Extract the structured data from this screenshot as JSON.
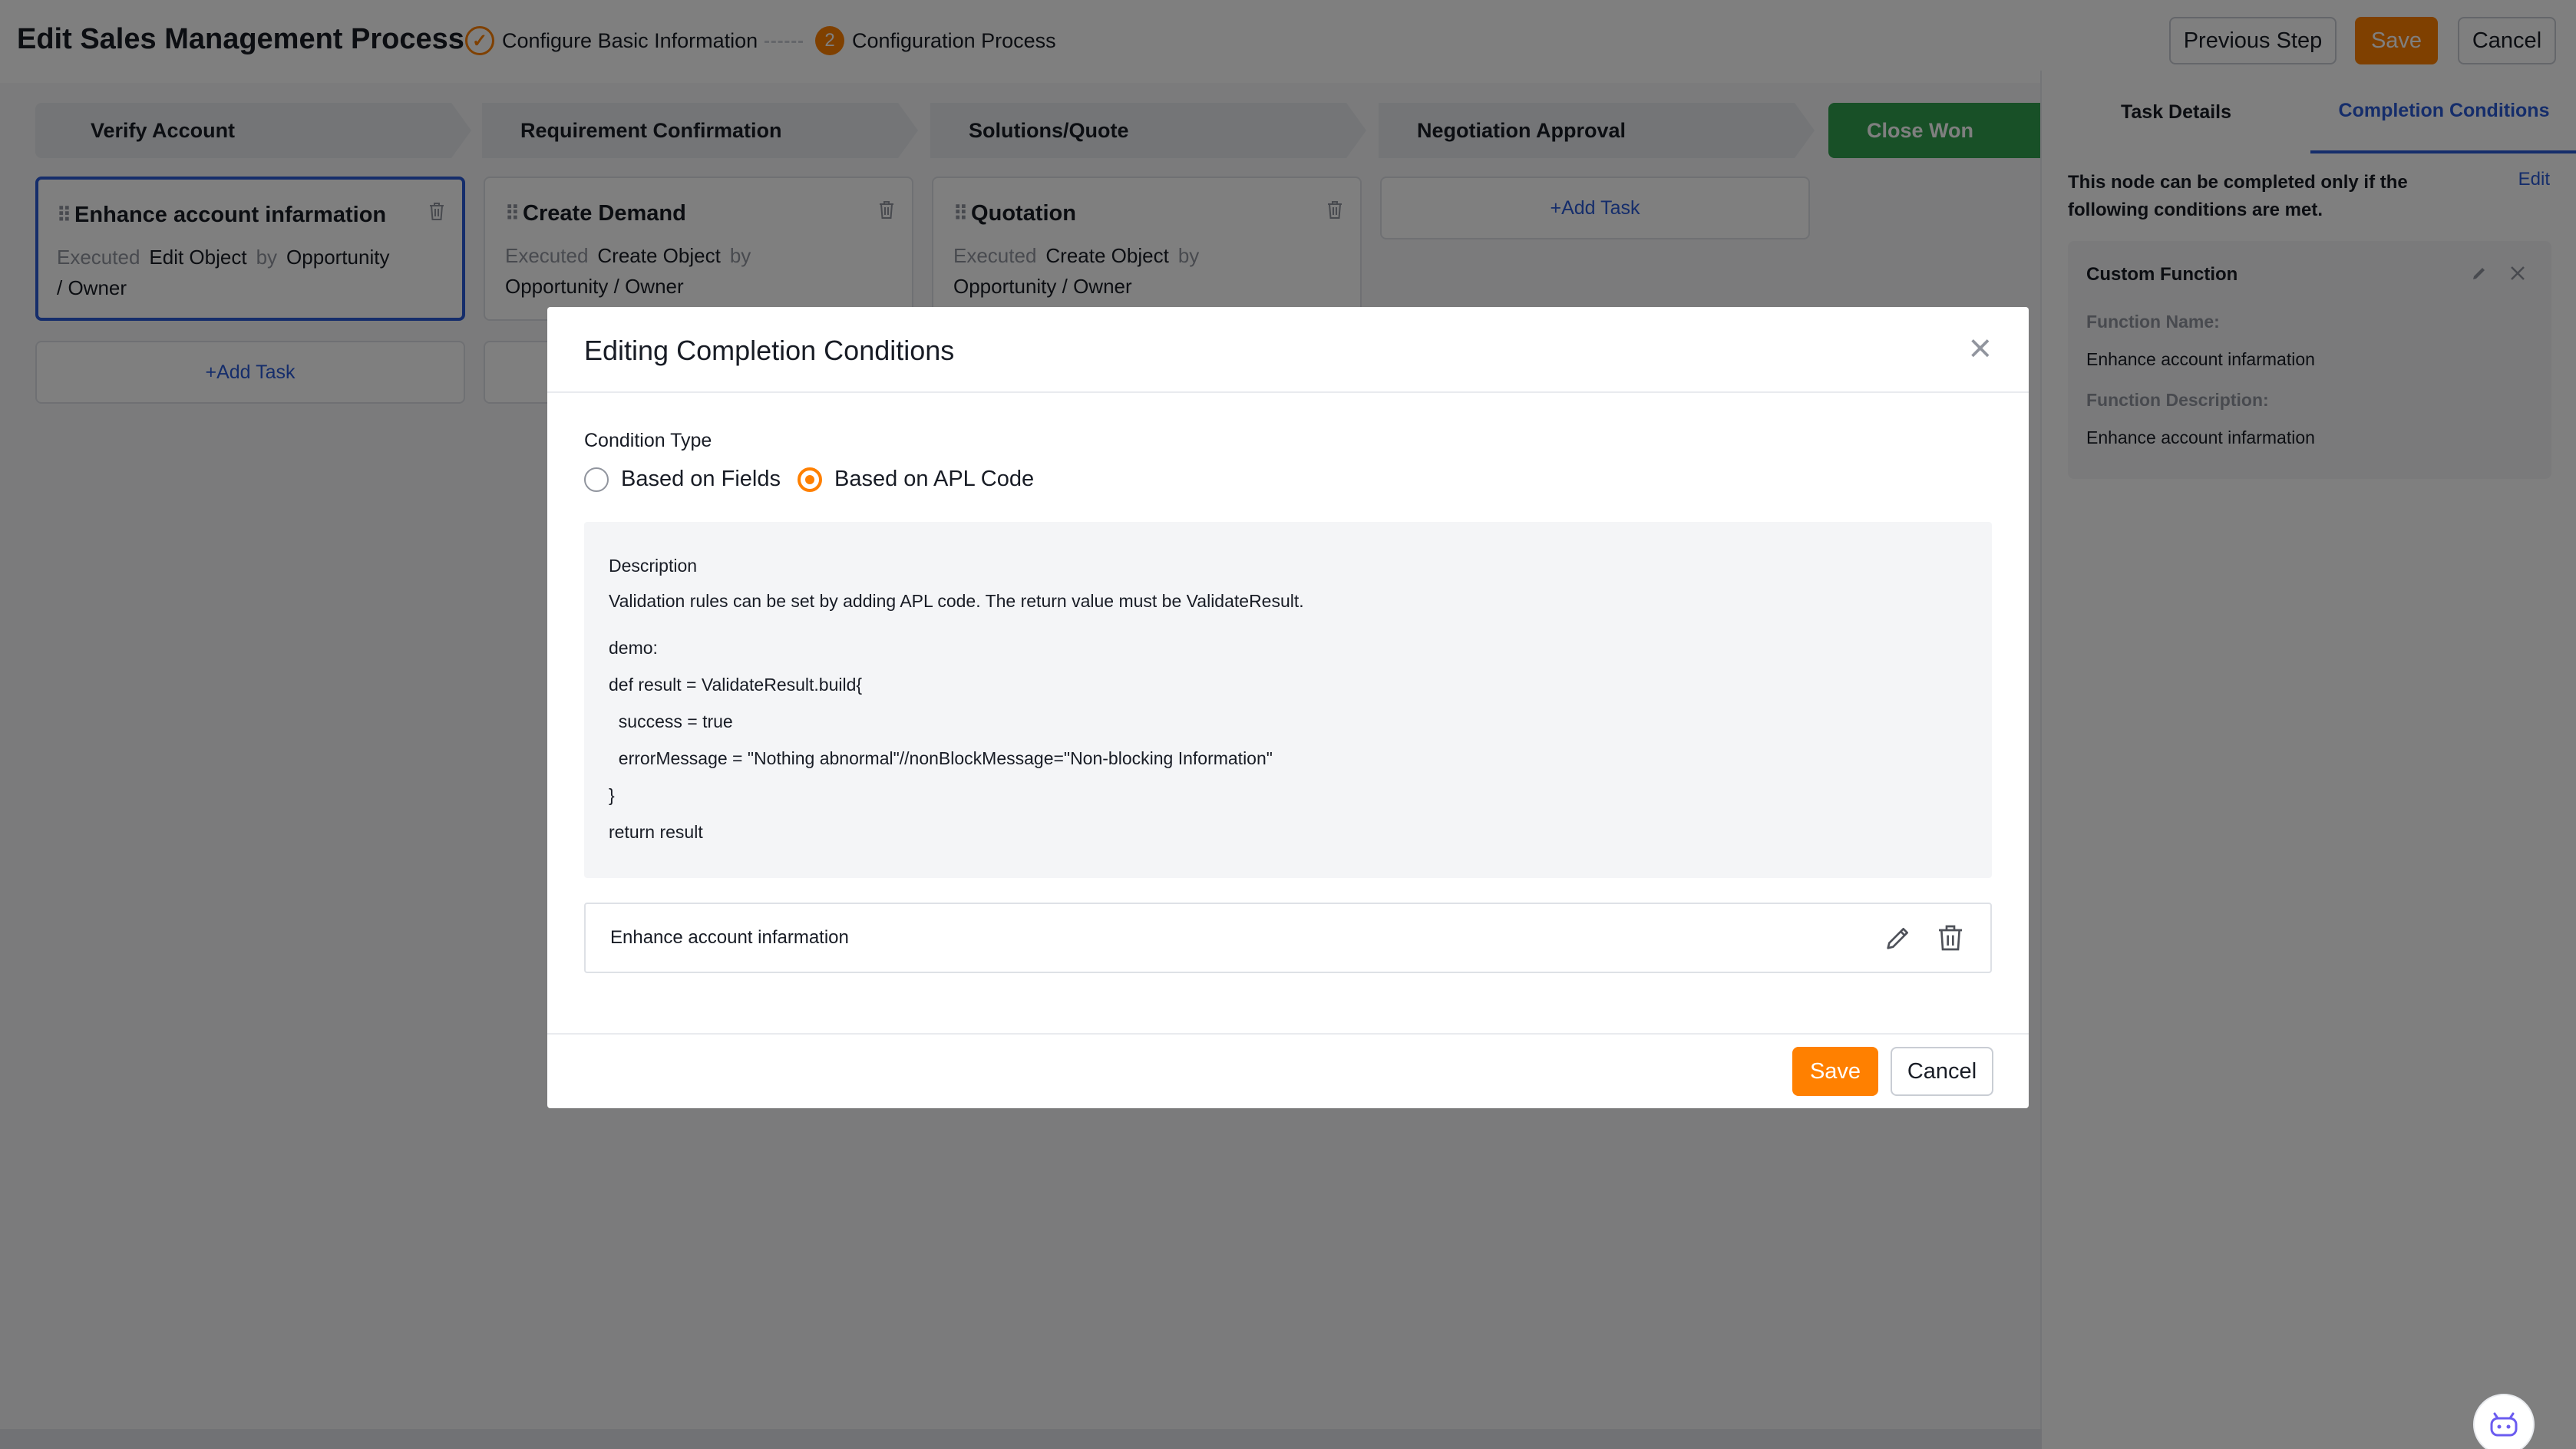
{
  "header": {
    "title": "Edit Sales Management Process",
    "steps": [
      {
        "label": "Configure Basic Information",
        "icon": "check-icon",
        "mark": "✓"
      },
      {
        "label": "Configuration Process",
        "number": "2"
      }
    ],
    "previous_label": "Previous Step",
    "save_label": "Save",
    "cancel_label": "Cancel"
  },
  "stages": [
    {
      "label": "Verify Account"
    },
    {
      "label": "Requirement Confirmation"
    },
    {
      "label": "Solutions/Quote"
    },
    {
      "label": "Negotiation Approval"
    },
    {
      "label": "Close Won"
    }
  ],
  "tasks": [
    {
      "title": "Enhance account infarmation",
      "executed": "Executed",
      "action": "Edit Object",
      "by": "by",
      "owner_line1": "Opportunity",
      "owner_line2": "/ Owner"
    },
    {
      "title": "Create Demand",
      "executed": "Executed",
      "action": "Create Object",
      "by": "by",
      "owner": "Opportunity / Owner"
    },
    {
      "title": "Quotation",
      "executed": "Executed",
      "action": "Create Object",
      "by": "by",
      "owner": "Opportunity / Owner"
    }
  ],
  "add_task_label": "+Add Task",
  "right_panel": {
    "tabs": [
      "Task Details",
      "Completion Conditions"
    ],
    "active_tab": "Completion Conditions",
    "note": "This node can be completed only if the following conditions are met.",
    "edit_label": "Edit",
    "box_title": "Custom Function",
    "function_name_label": "Function Name:",
    "function_name": "Enhance account infarmation",
    "function_desc_label": "Function Description:",
    "function_desc": "Enhance account infarmation"
  },
  "modal": {
    "title": "Editing Completion Conditions",
    "condition_type_label": "Condition Type",
    "options": [
      "Based on Fields",
      "Based on APL Code"
    ],
    "selected_option": "Based on APL Code",
    "description_heading": "Description",
    "description_text": "Validation rules can be set by adding APL code. The return value must be ValidateResult.",
    "code_lines": [
      "demo:",
      "def result = ValidateResult.build{",
      "  success = true",
      "  errorMessage = \"Nothing abnormal\"//nonBlockMessage=\"Non-blocking Information\"",
      "}",
      "return result"
    ],
    "function_item": "Enhance account infarmation",
    "save_label": "Save",
    "cancel_label": "Cancel"
  },
  "colors": {
    "accent": "#ff8000",
    "link": "#2a5bd7",
    "won_stage": "#30a14e"
  }
}
